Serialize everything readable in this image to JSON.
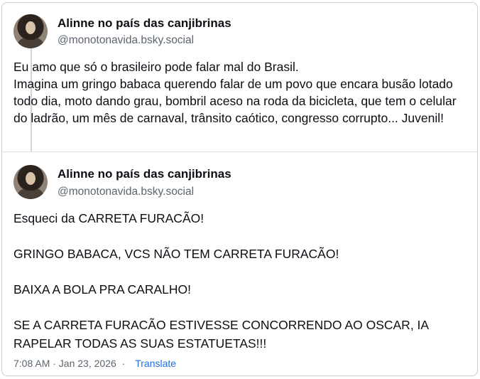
{
  "posts": [
    {
      "author_name": "Alinne no país das canjibrinas",
      "handle": "@monotonavida.bsky.social",
      "text_lines": [
        "Eu amo que só o brasileiro pode falar mal do Brasil.",
        "Imagina um gringo babaca querendo falar de um povo que encara busão lotado todo dia, moto dando grau, bombril aceso na roda da bicicleta, que tem o celular do ladrão, um mês de carnaval, trânsito caótico, congresso corrupto... Juvenil!"
      ]
    },
    {
      "author_name": "Alinne no país das canjibrinas",
      "handle": "@monotonavida.bsky.social",
      "paragraphs": [
        "Esqueci da CARRETA FURACÃO!",
        "GRINGO BABACA, VCS NÃO TEM CARRETA FURACÃO!",
        "BAIXA A BOLA PRA CARALHO!",
        "SE A CARRETA FURACÃO ESTIVESSE CONCORRENDO AO OSCAR, IA RAPELAR TODAS AS SUAS ESTATUETAS!!!"
      ],
      "timestamp": "7:08 AM · Jan 23, 2026",
      "separator": "·",
      "translate_label": "Translate"
    }
  ],
  "colors": {
    "link": "#1d6fd8",
    "muted": "#5b6570",
    "border": "#c9cfd6"
  }
}
